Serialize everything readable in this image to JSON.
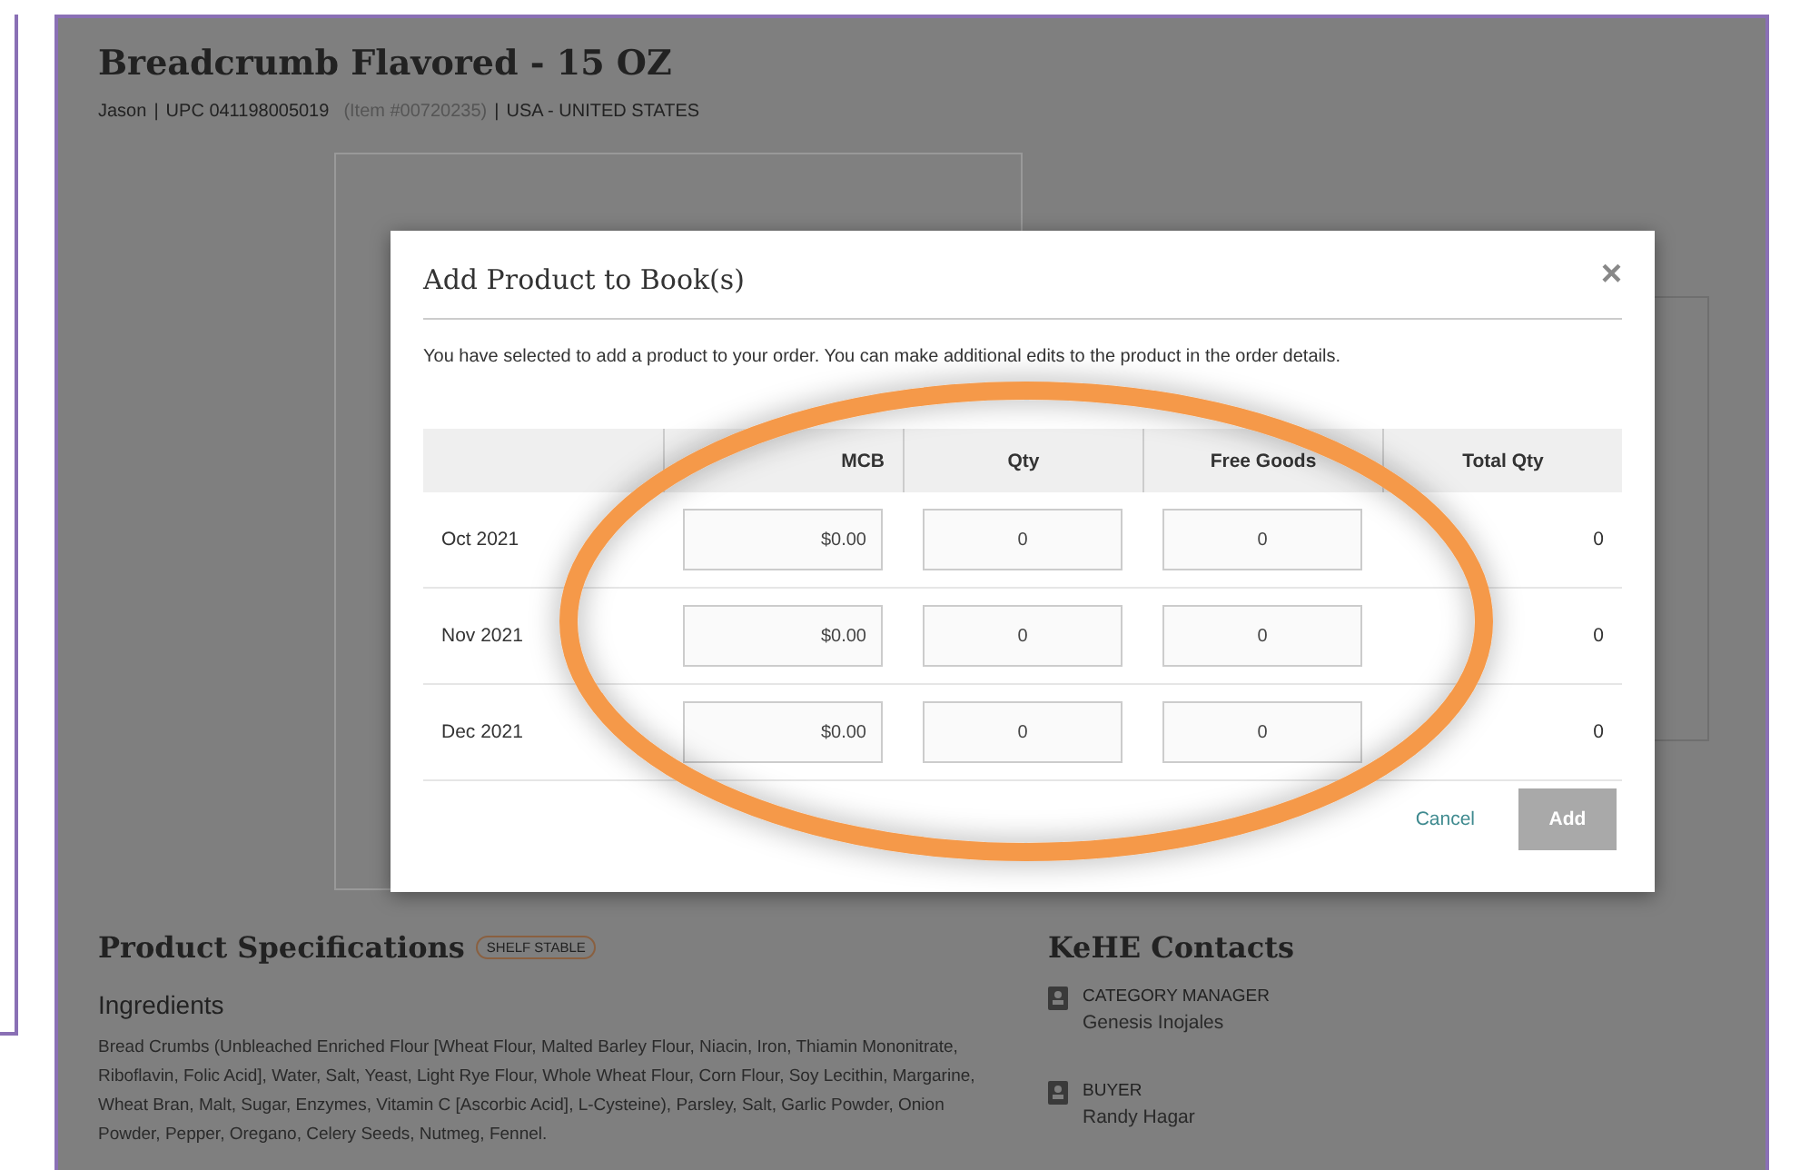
{
  "product": {
    "title": "Breadcrumb Flavored - 15 OZ",
    "brand": "Jason",
    "upc": "UPC 041198005019",
    "item": "(Item #00720235)",
    "origin": "USA - UNITED STATES",
    "separators": [
      "|",
      "|"
    ]
  },
  "specs": {
    "title": "Product Specifications",
    "badge": "SHELF STABLE",
    "ingredients_title": "Ingredients",
    "ingredients": "Bread Crumbs (Unbleached Enriched Flour [Wheat Flour, Malted Barley Flour, Niacin, Iron, Thiamin Mononitrate, Riboflavin, Folic Acid], Water, Salt, Yeast, Light Rye Flour, Whole Wheat Flour, Corn Flour, Soy Lecithin, Margarine, Wheat Bran, Malt, Sugar, Enzymes, Vitamin C [Ascorbic Acid], L-Cysteine), Parsley, Salt, Garlic Powder, Onion Powder, Pepper, Oregano, Celery Seeds, Nutmeg, Fennel."
  },
  "contacts": {
    "title": "KeHE Contacts",
    "items": [
      {
        "role": "CATEGORY MANAGER",
        "name": "Genesis Inojales"
      },
      {
        "role": "BUYER",
        "name": "Randy Hagar"
      }
    ]
  },
  "modal": {
    "title": "Add Product to Book(s)",
    "close": "×",
    "message": "You have selected to add a product to your order. You can make additional edits to the product in the order details.",
    "columns": [
      "MCB",
      "Qty",
      "Free Goods",
      "Total Qty"
    ],
    "rows": [
      {
        "month": "Oct 2021",
        "mcb": "$0.00",
        "qty": "0",
        "free_goods": "0",
        "total_qty": "0"
      },
      {
        "month": "Nov 2021",
        "mcb": "$0.00",
        "qty": "0",
        "free_goods": "0",
        "total_qty": "0"
      },
      {
        "month": "Dec 2021",
        "mcb": "$0.00",
        "qty": "0",
        "free_goods": "0",
        "total_qty": "0"
      }
    ],
    "cancel": "Cancel",
    "add": {
      "label": "Add",
      "disabled": true
    }
  }
}
